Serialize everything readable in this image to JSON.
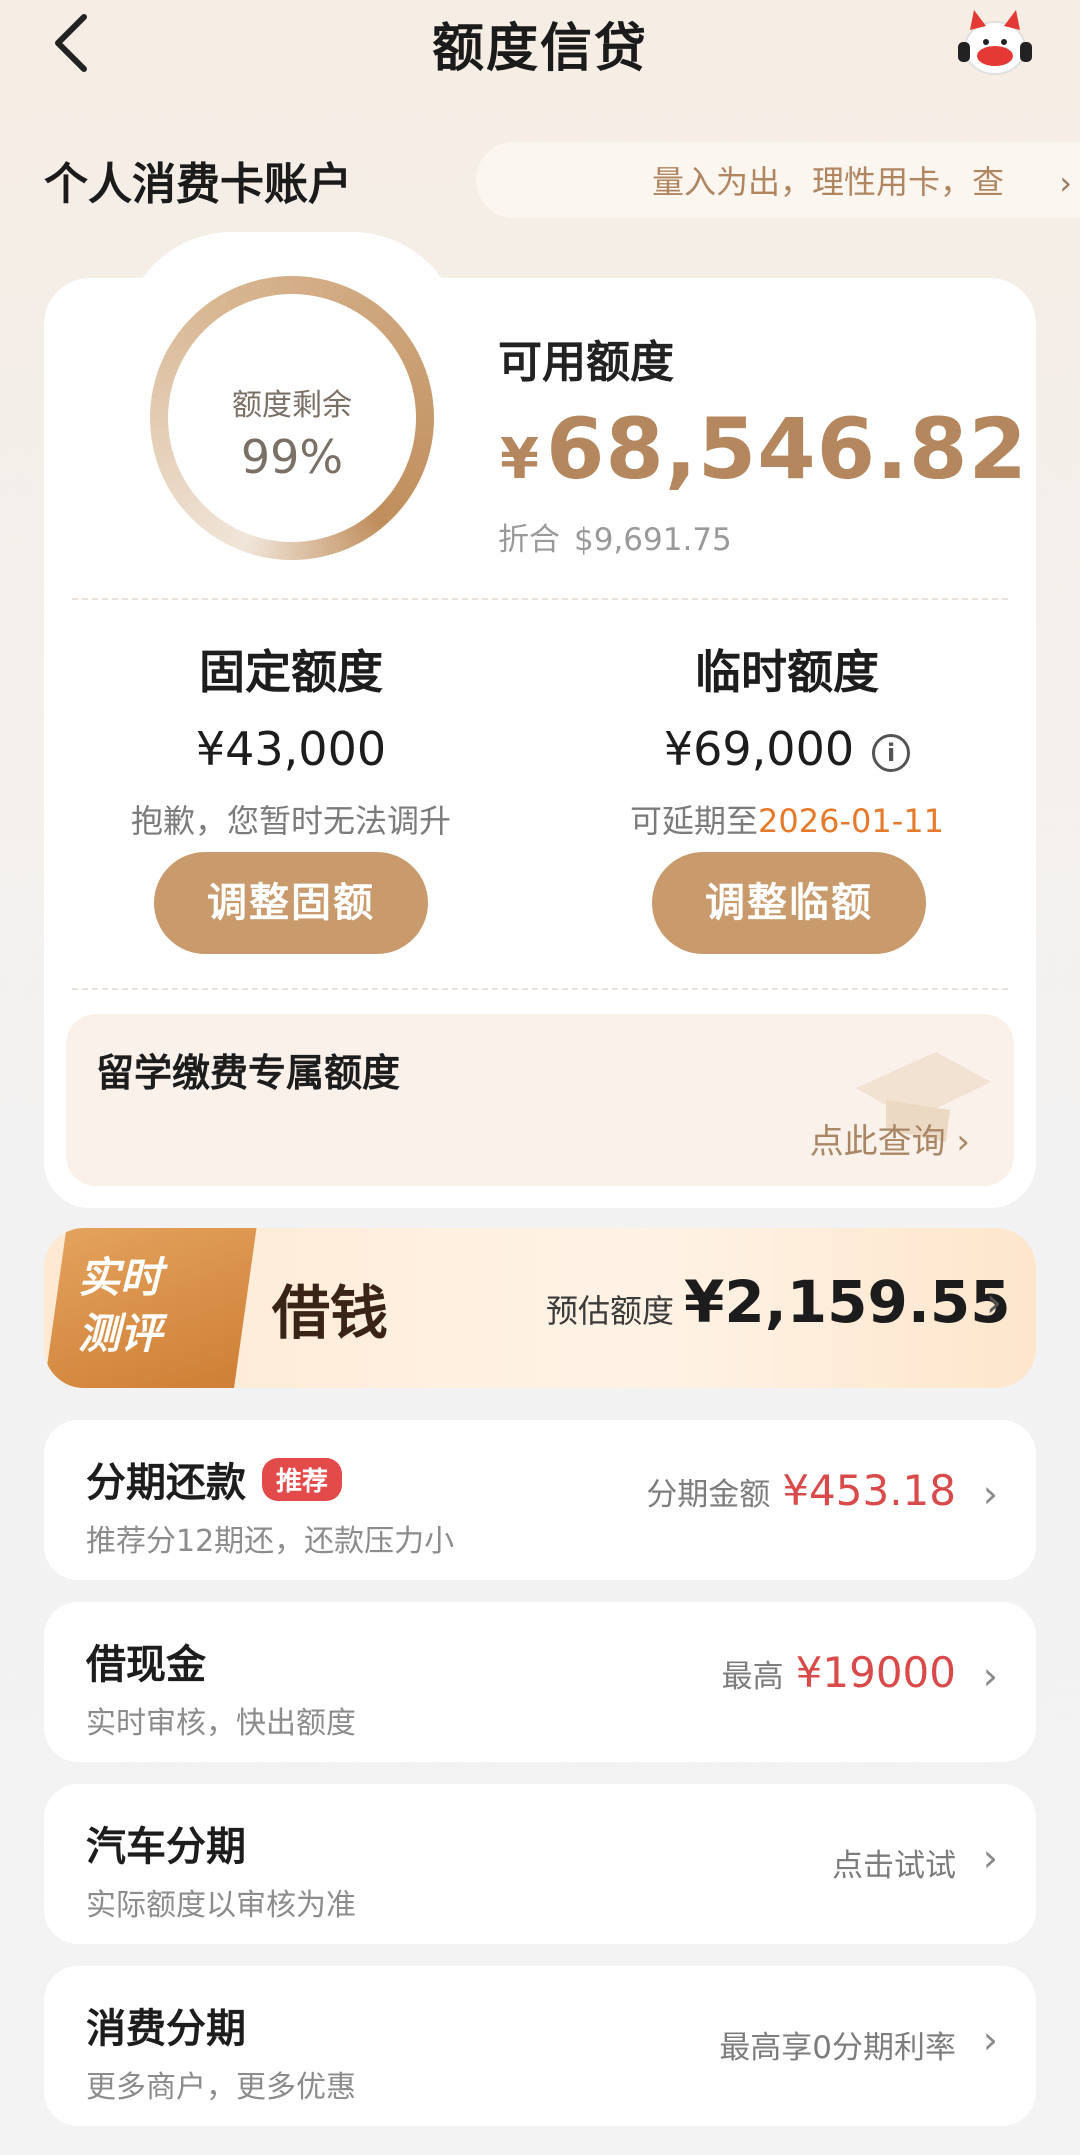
{
  "header": {
    "title": "额度信贷"
  },
  "account": {
    "title": "个人消费卡账户",
    "notice": "量入为出，理性用卡，查"
  },
  "summary": {
    "ring_label": "额度剩余",
    "ring_percent": "99%",
    "available_label": "可用额度",
    "available_currency": "¥",
    "available_amount": "68,546.82",
    "usd_label": "折合",
    "usd_amount": "$9,691.75"
  },
  "fixed": {
    "title": "固定额度",
    "amount": "¥43,000",
    "note": "抱歉，您暂时无法调升",
    "button": "调整固额"
  },
  "temp": {
    "title": "临时额度",
    "amount": "¥69,000",
    "note_prefix": "可延期至",
    "note_date": "2026-01-11",
    "button": "调整临额"
  },
  "study": {
    "title": "留学缴费专属额度",
    "link": "点此查询 ›"
  },
  "banner": {
    "tag_line1": "实时",
    "tag_line2": "测评",
    "title": "借钱",
    "est_label": "预估额度",
    "est_amount": "¥2,159.55"
  },
  "rows": [
    {
      "title": "分期还款",
      "badge": "推荐",
      "sub": "推荐分12期还，还款压力小",
      "right_label": "分期金额",
      "right_value": "¥453.18"
    },
    {
      "title": "借现金",
      "sub": "实时审核，快出额度",
      "right_label": "最高",
      "right_value": "¥19000"
    },
    {
      "title": "汽车分期",
      "sub": "实际额度以审核为准",
      "right_label": "点击试试"
    },
    {
      "title": "消费分期",
      "sub": "更多商户，更多优惠",
      "right_label": "最高享0分期利率"
    }
  ],
  "icons": [
    "back-arrow-icon",
    "mascot-icon",
    "chevron-right-icon",
    "info-icon",
    "graduation-cap-icon"
  ],
  "colors": {
    "accent": "#c89a6c",
    "gold_text": "#b4875e",
    "date_orange": "#e57a2b",
    "red": "#d94a4a"
  }
}
